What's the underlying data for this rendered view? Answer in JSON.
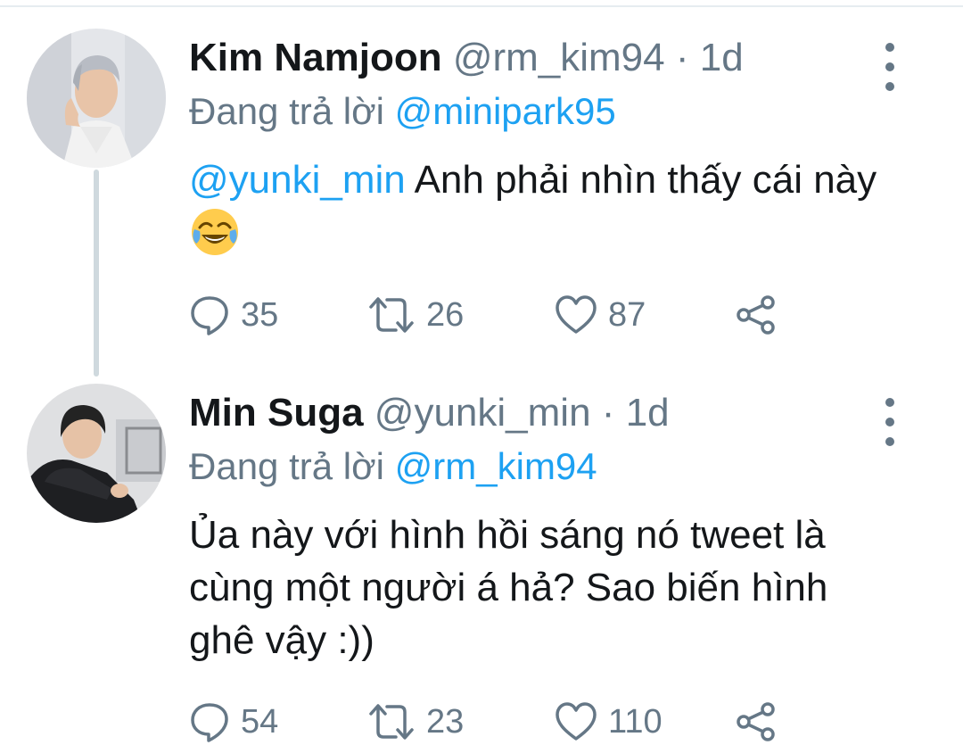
{
  "thread": [
    {
      "display_name": "Kim Namjoon",
      "handle": "@rm_kim94",
      "separator": "·",
      "time": "1d",
      "reply_prefix": "Đang trả lời",
      "reply_to": "@minipark95",
      "text_mention": "@yunki_min",
      "text": " Anh phải nhìn thấy cái này ",
      "emoji": "face-with-tears-of-joy",
      "stats": {
        "replies": "35",
        "retweets": "26",
        "likes": "87"
      }
    },
    {
      "display_name": "Min Suga",
      "handle": "@yunki_min",
      "separator": "·",
      "time": "1d",
      "reply_prefix": "Đang trả lời",
      "reply_to": "@rm_kim94",
      "text": "Ủa này với hình hồi sáng nó tweet là cùng một người á hả? Sao biến hình ghê vậy :))",
      "stats": {
        "replies": "54",
        "retweets": "23",
        "likes": "110"
      }
    }
  ],
  "icons": {
    "reply": "comment-bubble-icon",
    "retweet": "retweet-icon",
    "like": "heart-icon",
    "share": "share-icon",
    "more": "more-vertical-icon"
  },
  "colors": {
    "link": "#1da1f2",
    "secondary_text": "#657786",
    "primary_text": "#14171a",
    "thread_line": "#cfd9de"
  }
}
